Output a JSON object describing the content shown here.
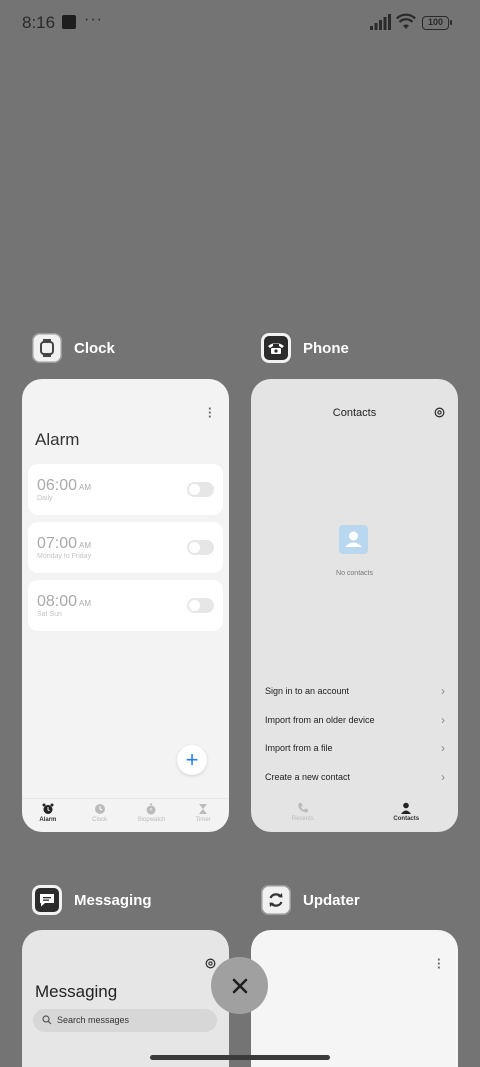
{
  "status_bar": {
    "time": "8:16",
    "battery": "100"
  },
  "apps": {
    "clock": {
      "name": "Clock",
      "title": "Alarm",
      "alarms": [
        {
          "time": "06:00",
          "ampm": "AM",
          "repeat": "Daily"
        },
        {
          "time": "07:00",
          "ampm": "AM",
          "repeat": "Monday to Friday"
        },
        {
          "time": "08:00",
          "ampm": "AM",
          "repeat": "Sat Sun"
        }
      ],
      "nav": [
        "Alarm",
        "Clock",
        "Stopwatch",
        "Timer"
      ]
    },
    "phone": {
      "name": "Phone",
      "title": "Contacts",
      "empty_text": "No contacts",
      "actions": [
        "Sign in to an account",
        "Import from an older device",
        "Import from a file",
        "Create a new contact"
      ],
      "nav": [
        "Recents",
        "Contacts"
      ]
    },
    "messaging": {
      "name": "Messaging",
      "title": "Messaging",
      "search_placeholder": "Search messages"
    },
    "updater": {
      "name": "Updater"
    }
  },
  "icons": {
    "clock_app": "smartwatch-icon",
    "phone_app": "telephone-icon",
    "messaging_app": "chat-bubble-icon",
    "updater_app": "refresh-icon",
    "close": "close-icon"
  }
}
